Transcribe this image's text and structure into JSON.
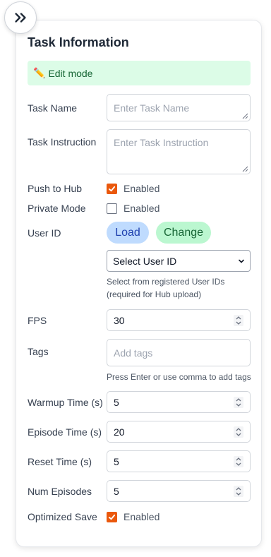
{
  "panel": {
    "collapse_icon": "chevrons-right-icon",
    "title": "Task Information",
    "edit_banner": {
      "icon": "pencil-icon",
      "text": "Edit mode"
    }
  },
  "task_name": {
    "label": "Task Name",
    "placeholder": "Enter Task Name",
    "value": ""
  },
  "task_instruction": {
    "label": "Task Instruction",
    "placeholder": "Enter Task Instruction",
    "value": ""
  },
  "push_to_hub": {
    "label": "Push to Hub",
    "checked": true,
    "text": "Enabled"
  },
  "private_mode": {
    "label": "Private Mode",
    "checked": false,
    "text": "Enabled"
  },
  "user_id": {
    "label": "User ID",
    "load_label": "Load",
    "change_label": "Change",
    "select_value": "Select User ID",
    "help_line1": "Select from registered User IDs",
    "help_line2": "(required for Hub upload)"
  },
  "fps": {
    "label": "FPS",
    "value": "30"
  },
  "tags": {
    "label": "Tags",
    "placeholder": "Add tags",
    "help": "Press Enter or use comma to add tags"
  },
  "warmup_time": {
    "label": "Warmup Time (s)",
    "value": "5"
  },
  "episode_time": {
    "label": "Episode Time (s)",
    "value": "20"
  },
  "reset_time": {
    "label": "Reset Time (s)",
    "value": "5"
  },
  "num_episodes": {
    "label": "Num Episodes",
    "value": "5"
  },
  "optimized_save": {
    "label": "Optimized Save",
    "checked": true,
    "text": "Enabled"
  },
  "colors": {
    "checkbox_on": "#ea580c",
    "banner_bg": "#dcfce7",
    "load_bg": "#bfdbfe",
    "change_bg": "#bbf7d0"
  }
}
